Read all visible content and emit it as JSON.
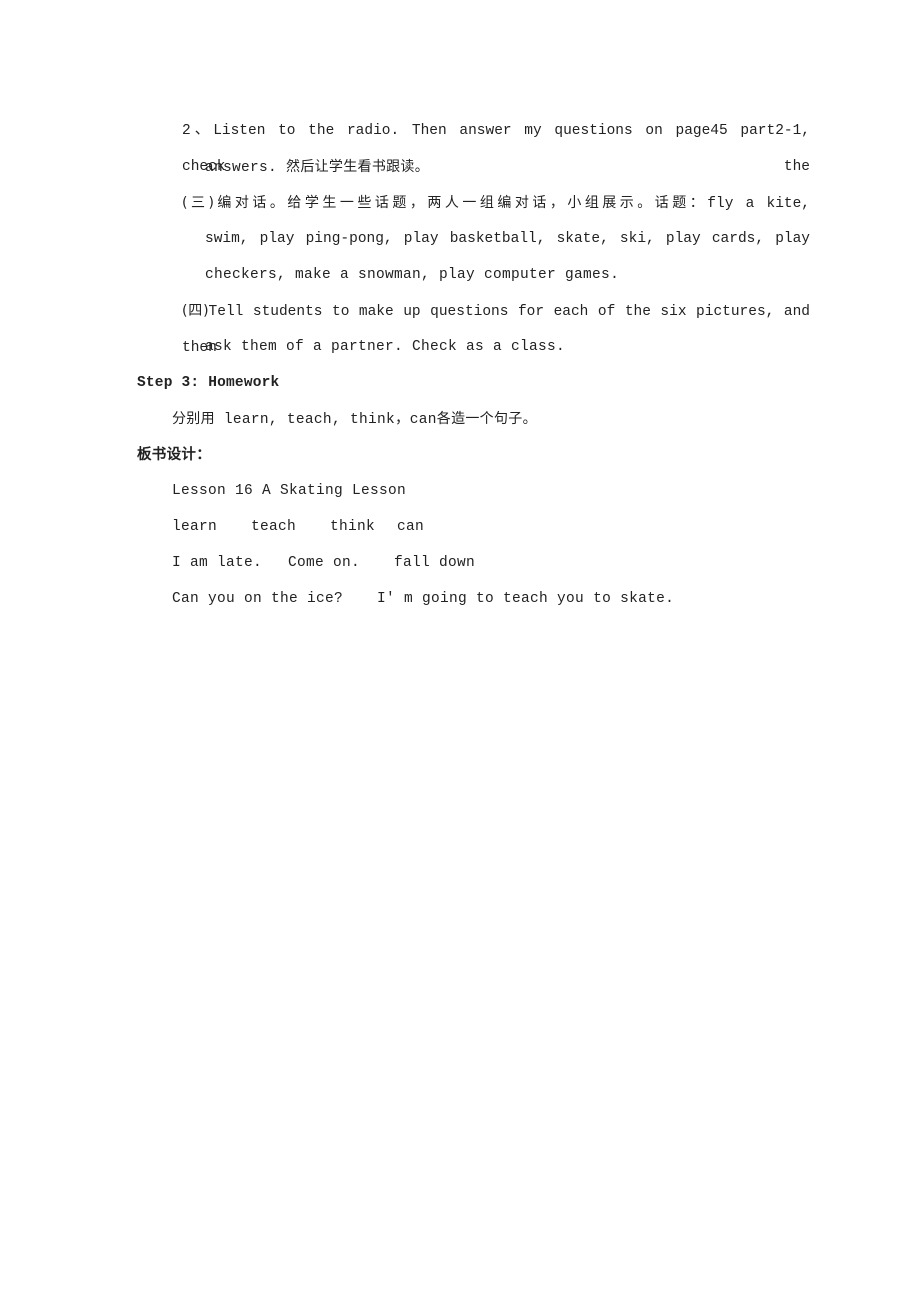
{
  "document": {
    "type": "lesson-plan-page",
    "background_color": "#ffffff",
    "text_color": "#222222"
  },
  "body": {
    "item_2": {
      "marker": "2、",
      "line1": "Listen to the radio. Then answer my questions on page45 part2-1, check the",
      "line2": "answers.",
      "line2_cjk": "然后让学生看书跟读。"
    },
    "item_3": {
      "marker": "(三)",
      "line1_cjk": "编对话。给学生一些话题，两人一组编对话，小组展示。话题：",
      "line1_tail": "fly a kite,",
      "line2": "swim, play ping-pong, play basketball, skate, ski, play cards, play",
      "line3": "checkers, make a snowman, play computer games."
    },
    "item_4": {
      "marker": "(四)",
      "line1": "Tell students to make up questions for each of the six pictures, and then",
      "line2": "ask them of a partner. Check as a class."
    },
    "step3": {
      "heading": "Step 3: Homework",
      "homework_cjk_prefix": "分别用",
      "homework_words": "learn, teach, think，can",
      "homework_cjk_suffix": "各造一个句子。"
    },
    "board_design": {
      "heading": "板书设计：",
      "title": "Lesson 16 A Skating Lesson",
      "verbs": [
        "learn",
        "teach",
        "think",
        "can"
      ],
      "phrases": [
        "I am late.",
        "Come on.",
        "fall down"
      ],
      "sentences": [
        "Can you on the ice?",
        "I' m going to teach you to skate."
      ]
    }
  }
}
